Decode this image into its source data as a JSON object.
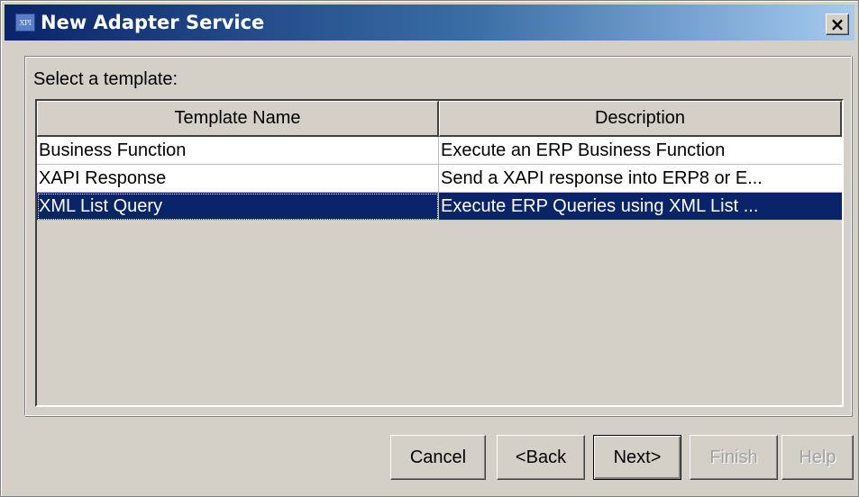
{
  "window": {
    "title": "New Adapter Service",
    "icon_text": "XPI",
    "close_glyph": "×"
  },
  "prompt": "Select a template:",
  "table": {
    "columns": [
      "Template Name",
      "Description"
    ],
    "rows": [
      {
        "name": "Business Function",
        "description": "Execute an ERP Business Function"
      },
      {
        "name": "XAPI Response",
        "description": "Send a XAPI response into ERP8 or E..."
      },
      {
        "name": "XML List Query",
        "description": "Execute ERP Queries using XML List ..."
      }
    ],
    "selected_row": "XML List Query"
  },
  "buttons": {
    "cancel": "Cancel",
    "back": "<Back",
    "next": "Next>",
    "finish": "Finish",
    "help": "Help"
  },
  "colors": {
    "selection": "#0a246a",
    "titlebar_start": "#0a246a",
    "titlebar_end": "#a6caf0",
    "face": "#d4d0c8"
  }
}
